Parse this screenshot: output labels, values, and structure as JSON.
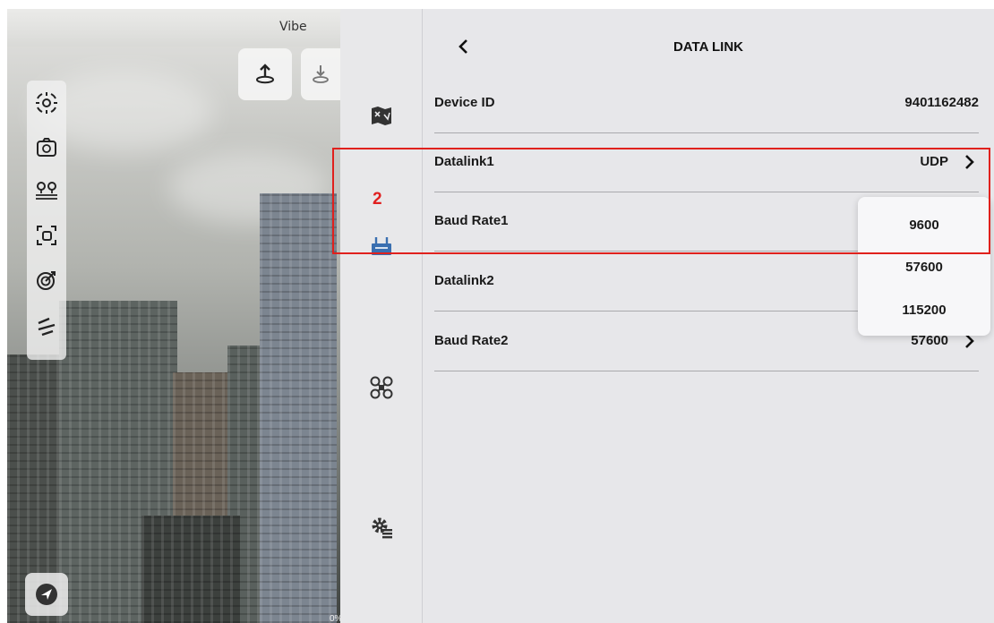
{
  "camera": {
    "top_label": "Vibe",
    "percent": "0%",
    "top_buttons": [
      {
        "icon": "upload-takeoff-icon"
      },
      {
        "icon": "land-icon"
      }
    ],
    "tools": [
      {
        "icon": "crosshair-target-icon"
      },
      {
        "icon": "camera-switch-icon"
      },
      {
        "icon": "waypoint-pins-icon"
      },
      {
        "icon": "focus-frame-icon"
      },
      {
        "icon": "radar-icon"
      },
      {
        "icon": "flight-path-icon"
      }
    ],
    "nav_button": {
      "icon": "navigate-arrow-icon"
    }
  },
  "rail": {
    "items": [
      {
        "name": "map-icon"
      },
      {
        "name": "datalink-icon",
        "active": true
      },
      {
        "name": "drone-icon"
      },
      {
        "name": "settings-gear-icon"
      }
    ],
    "annotation": "2"
  },
  "panel": {
    "title": "DATA LINK",
    "rows": [
      {
        "label": "Device ID",
        "value": "9401162482"
      },
      {
        "label": "Datalink1",
        "value": "UDP"
      },
      {
        "label": "Baud Rate1",
        "value": "9600"
      },
      {
        "label": "Datalink2",
        "value": ""
      },
      {
        "label": "Baud Rate2",
        "value": "57600"
      }
    ],
    "dropdown": {
      "selected": "9600",
      "options": [
        "9600",
        "57600",
        "115200"
      ]
    }
  },
  "colors": {
    "accent": "#3a6fb0",
    "highlight": "#e0211d",
    "panel_bg": "#e7e7ea"
  }
}
